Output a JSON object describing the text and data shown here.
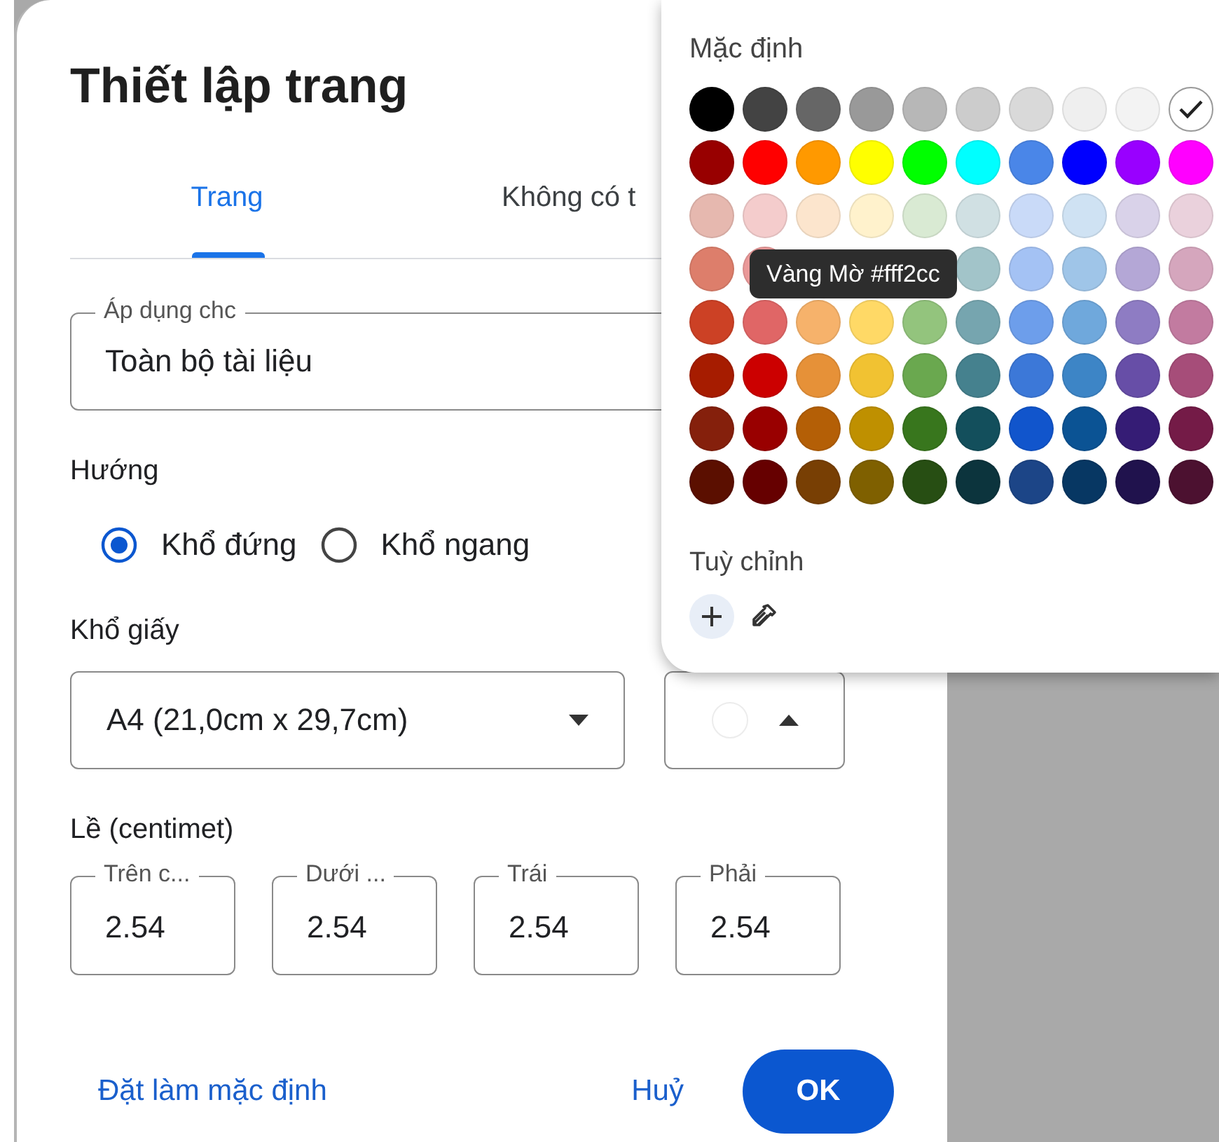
{
  "dialog": {
    "title": "Thiết lập trang",
    "tabs": [
      {
        "label": "Trang",
        "selected": true
      },
      {
        "label": "Không có t",
        "selected": false
      }
    ],
    "apply_to": {
      "label": "Áp dụng chc",
      "value": "Toàn bộ tài liệu"
    },
    "orientation": {
      "label": "Hướng",
      "options": [
        {
          "label": "Khổ đứng",
          "selected": true
        },
        {
          "label": "Khổ ngang",
          "selected": false
        }
      ]
    },
    "paper_size": {
      "label": "Khổ giấy",
      "value": "A4 (21,0cm x 29,7cm)"
    },
    "page_color": {
      "color": "#ffffff",
      "expanded": true
    },
    "margins": {
      "label": "Lề (centimet)",
      "fields": [
        {
          "label": "Trên c...",
          "value": "2.54"
        },
        {
          "label": "Dưới ...",
          "value": "2.54"
        },
        {
          "label": "Trái",
          "value": "2.54"
        },
        {
          "label": "Phải",
          "value": "2.54"
        }
      ]
    },
    "buttons": {
      "set_default": "Đặt làm mặc định",
      "cancel": "Huỷ",
      "ok": "OK"
    }
  },
  "palette": {
    "title": "Mặc định",
    "rows": [
      [
        {
          "color": "#000000",
          "selected": false
        },
        {
          "color": "#434343",
          "selected": false
        },
        {
          "color": "#666666",
          "selected": false
        },
        {
          "color": "#999999",
          "selected": false
        },
        {
          "color": "#b7b7b7",
          "selected": false
        },
        {
          "color": "#cccccc",
          "selected": false
        },
        {
          "color": "#d9d9d9",
          "selected": false
        },
        {
          "color": "#efefef",
          "selected": false
        },
        {
          "color": "#f3f3f3",
          "selected": false
        },
        {
          "color": "#ffffff",
          "selected": true
        }
      ],
      [
        {
          "color": "#980000",
          "selected": false
        },
        {
          "color": "#ff0000",
          "selected": false
        },
        {
          "color": "#ff9900",
          "selected": false
        },
        {
          "color": "#ffff00",
          "selected": false
        },
        {
          "color": "#00ff00",
          "selected": false
        },
        {
          "color": "#00ffff",
          "selected": false
        },
        {
          "color": "#4a86e8",
          "selected": false
        },
        {
          "color": "#0000ff",
          "selected": false
        },
        {
          "color": "#9900ff",
          "selected": false
        },
        {
          "color": "#ff00ff",
          "selected": false
        }
      ],
      [
        {
          "color": "#e6b8af",
          "selected": false
        },
        {
          "color": "#f4cccc",
          "selected": false
        },
        {
          "color": "#fce5cd",
          "selected": false
        },
        {
          "color": "#fff2cc",
          "selected": false
        },
        {
          "color": "#d9ead3",
          "selected": false
        },
        {
          "color": "#d0e0e3",
          "selected": false
        },
        {
          "color": "#c9daf8",
          "selected": false
        },
        {
          "color": "#cfe2f3",
          "selected": false
        },
        {
          "color": "#d9d2e9",
          "selected": false
        },
        {
          "color": "#ead1dc",
          "selected": false
        }
      ],
      [
        {
          "color": "#dd7e6b",
          "selected": false
        },
        {
          "color": "#ea9999",
          "selected": false
        },
        null,
        null,
        null,
        {
          "color": "#a2c4c9",
          "selected": false
        },
        {
          "color": "#a4c2f4",
          "selected": false
        },
        {
          "color": "#9fc5e8",
          "selected": false
        },
        {
          "color": "#b4a7d6",
          "selected": false
        },
        {
          "color": "#d5a6bd",
          "selected": false
        }
      ],
      [
        {
          "color": "#cc4125",
          "selected": false
        },
        {
          "color": "#e06666",
          "selected": false
        },
        {
          "color": "#f6b26b",
          "selected": false
        },
        {
          "color": "#ffd966",
          "selected": false
        },
        {
          "color": "#93c47d",
          "selected": false
        },
        {
          "color": "#76a5af",
          "selected": false
        },
        {
          "color": "#6d9eeb",
          "selected": false
        },
        {
          "color": "#6fa8dc",
          "selected": false
        },
        {
          "color": "#8e7cc3",
          "selected": false
        },
        {
          "color": "#c27ba0",
          "selected": false
        }
      ],
      [
        {
          "color": "#a61c00",
          "selected": false
        },
        {
          "color": "#cc0000",
          "selected": false
        },
        {
          "color": "#e69138",
          "selected": false
        },
        {
          "color": "#f1c232",
          "selected": false
        },
        {
          "color": "#6aa84f",
          "selected": false
        },
        {
          "color": "#45818e",
          "selected": false
        },
        {
          "color": "#3c78d8",
          "selected": false
        },
        {
          "color": "#3d85c6",
          "selected": false
        },
        {
          "color": "#674ea7",
          "selected": false
        },
        {
          "color": "#a64d79",
          "selected": false
        }
      ],
      [
        {
          "color": "#85200c",
          "selected": false
        },
        {
          "color": "#990000",
          "selected": false
        },
        {
          "color": "#b45f06",
          "selected": false
        },
        {
          "color": "#bf9000",
          "selected": false
        },
        {
          "color": "#38761d",
          "selected": false
        },
        {
          "color": "#134f5c",
          "selected": false
        },
        {
          "color": "#1155cc",
          "selected": false
        },
        {
          "color": "#0b5394",
          "selected": false
        },
        {
          "color": "#351c75",
          "selected": false
        },
        {
          "color": "#741b47",
          "selected": false
        }
      ],
      [
        {
          "color": "#5b0f00",
          "selected": false
        },
        {
          "color": "#660000",
          "selected": false
        },
        {
          "color": "#783f04",
          "selected": false
        },
        {
          "color": "#7f6000",
          "selected": false
        },
        {
          "color": "#274e13",
          "selected": false
        },
        {
          "color": "#0c343d",
          "selected": false
        },
        {
          "color": "#1c4587",
          "selected": false
        },
        {
          "color": "#073763",
          "selected": false
        },
        {
          "color": "#20124d",
          "selected": false
        },
        {
          "color": "#4c1130",
          "selected": false
        }
      ]
    ],
    "tooltip": "Vàng Mờ #fff2cc",
    "custom_label": "Tuỳ chỉnh"
  }
}
